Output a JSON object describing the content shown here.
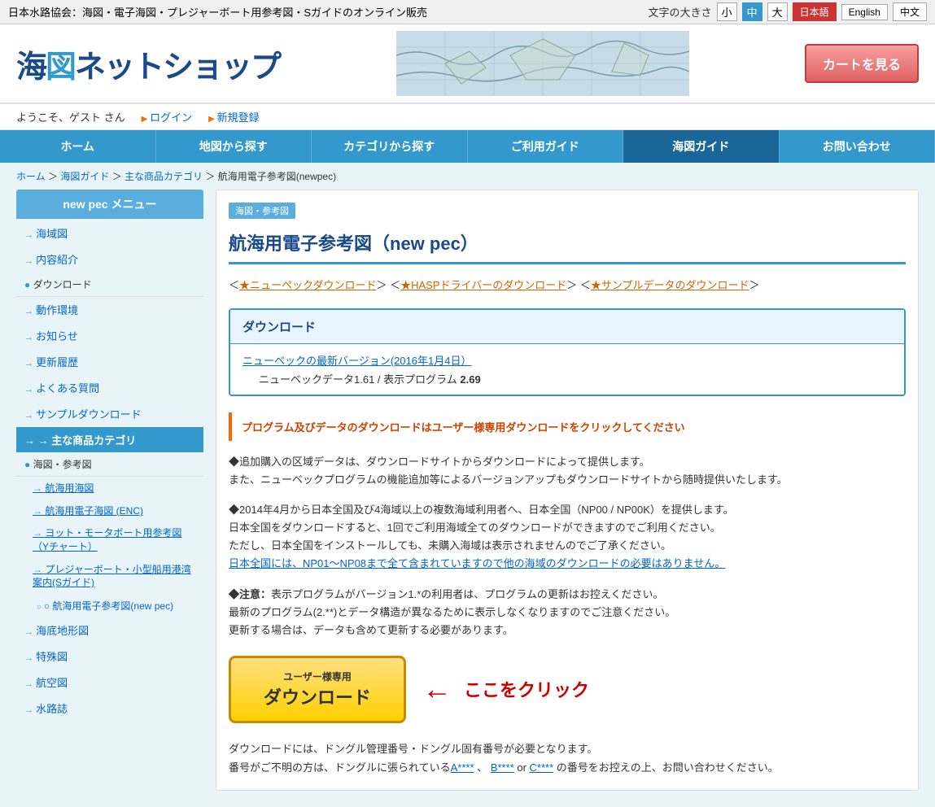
{
  "topbar": {
    "left_text": "日本水路協会：海図・電子海図・プレジャーボート用参考図・Sガイドのオンライン販売",
    "font_size_label": "文字の大きさ",
    "font_small": "小",
    "font_mid": "中",
    "font_large": "大",
    "lang_ja": "日本語",
    "lang_en": "English",
    "lang_zh": "中文"
  },
  "header": {
    "logo": "海図ネットショップ",
    "cart_btn": "カートを見る"
  },
  "userbar": {
    "welcome": "ようこそ、ゲスト さん",
    "login": "ログイン",
    "register": "新規登録"
  },
  "nav": {
    "items": [
      "ホーム",
      "地図から探す",
      "カテゴリから探す",
      "ご利用ガイド",
      "海図ガイド",
      "お問い合わせ"
    ]
  },
  "breadcrumb": {
    "items": [
      "ホーム",
      "海図ガイド",
      "主な商品カテゴリ"
    ],
    "current": "航海用電子参考図(newpec)"
  },
  "sidebar": {
    "header": "new pec メニュー",
    "items": [
      {
        "label": "海域図",
        "type": "link"
      },
      {
        "label": "内容紹介",
        "type": "link"
      },
      {
        "label": "ダウンロード",
        "type": "category"
      },
      {
        "label": "動作環境",
        "type": "link"
      },
      {
        "label": "お知らせ",
        "type": "link"
      },
      {
        "label": "更新履歴",
        "type": "link"
      },
      {
        "label": "よくある質問",
        "type": "link"
      },
      {
        "label": "サンプルダウンロード",
        "type": "link"
      },
      {
        "label": "主な商品カテゴリ",
        "type": "active"
      },
      {
        "label": "海図・参考図",
        "type": "category"
      },
      {
        "label": "航海用海図",
        "type": "sub"
      },
      {
        "label": "航海用電子海図 (ENC)",
        "type": "sub"
      },
      {
        "label": "ヨット・モータボート用参考図（Yチャート）",
        "type": "sub"
      },
      {
        "label": "プレジャーボート・小型船用港湾案内(Sガイド)",
        "type": "sub"
      },
      {
        "label": "航海用電子参考図(new pec)",
        "type": "leaf-active"
      },
      {
        "label": "海底地形図",
        "type": "link"
      },
      {
        "label": "特殊図",
        "type": "link"
      },
      {
        "label": "航空図",
        "type": "link"
      },
      {
        "label": "水路誌",
        "type": "link"
      }
    ]
  },
  "content": {
    "category_label": "海図・参考図",
    "title": "航海用電子参考図（new pec）",
    "links": {
      "prefix1": "＜",
      "link1": "★ニューペックダウンロード",
      "mid1": "＞ ＜",
      "link2": "★HASPドライバーのダウンロード",
      "mid2": "＞ ＜",
      "link3": "★サンプルデータのダウンロード",
      "suffix3": "＞"
    },
    "download_section": {
      "header": "ダウンロード",
      "version_link": "ニューベックの最新バージョン(2016年1月4日）",
      "version_detail": "ニューベックデータ1.61 / 表示プログラム",
      "version_number": "2.69"
    },
    "notice": "プログラム及びデータのダウンロードはユーザー様専用ダウンロードをクリックしてください",
    "para1": "◆追加購入の区域データは、ダウンロードサイトからダウンロードによって提供します。\nまた、ニューベックプログラムの機能追加等によるバージョンアップもダウンロードサイトから随時提供いたします。",
    "para2_line1": "◆2014年4月から日本全国及び4海域以上の複数海域利用者へ、日本全国（NP00 / NP00K）を提供します。",
    "para2_line2": "日本全国をダウンロードすると、1回でご利用海域全てのダウンロードができますのでご利用ください。",
    "para2_line3": "ただし、日本全国をインストールしても、未購入海域は表示されませんのでご了承ください。",
    "para2_line4": "日本全国には、NP01〜NP08まで全て含まれていますので他の海域のダウンロードの必要はありません。",
    "para3_head": "◆注意：",
    "para3_line1": "表示プログラムがバージョン1.*の利用者は、プログラムの更新はお控えください。",
    "para3_line2": "最新のプログラム(2.**)とデータ構造が異なるために表示しなくなりますのでご注意ください。",
    "para3_line3": "更新する場合は、データも含めて更新する必要があります。",
    "download_btn": {
      "small": "ユーザー様専用",
      "big": "ダウンロード"
    },
    "click_here": "ここをクリック",
    "footer_line1": "ダウンロードには、ドングル管理番号・ドングル固有番号が必要となります。",
    "footer_line2_pre": "番号がご不明の方は、ドングルに張られている",
    "footer_link1": "A****",
    "footer_mid1": "、",
    "footer_link2": "B****",
    "footer_mid2": " or ",
    "footer_link3": "C****",
    "footer_line2_post": " の番号をお控えの上、お問い合わせください。"
  }
}
